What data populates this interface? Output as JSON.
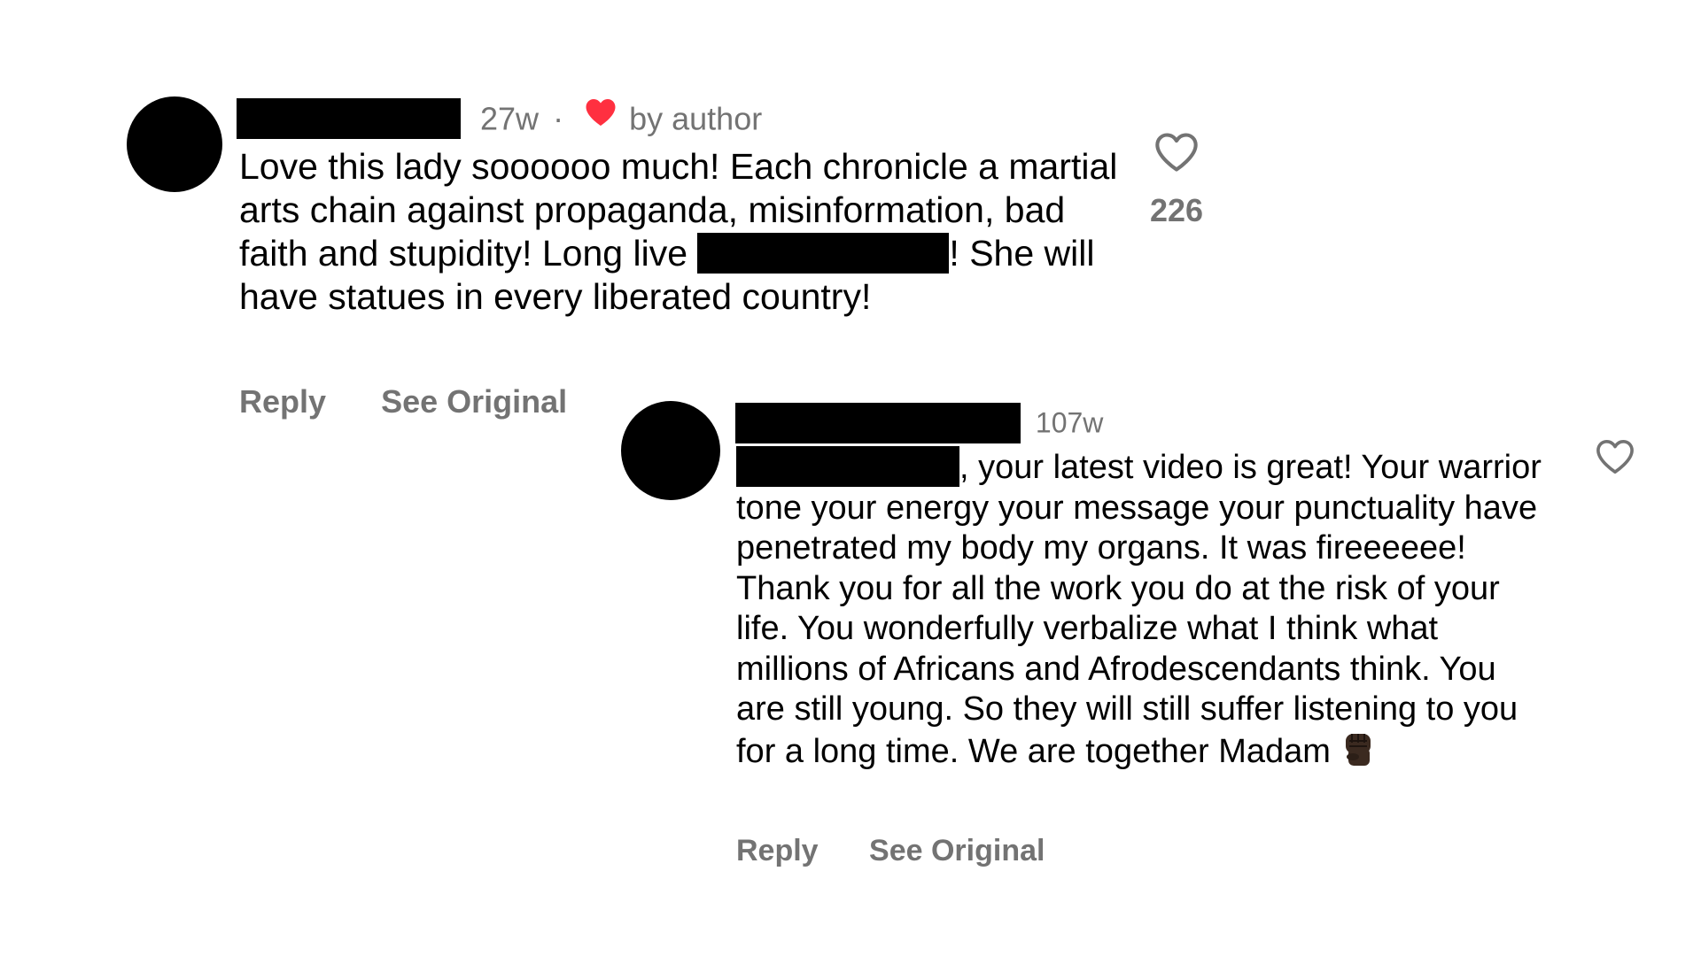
{
  "comments": [
    {
      "time": "27w",
      "separator": "·",
      "liked_by_author": "by author",
      "text_before_mention": "Love this lady soooooo much! Each chronicle a martial arts chain against propaganda, misinformation, bad faith and stupidity! Long live",
      "text_after_mention": "! She will have statues in every liberated country!",
      "like_count": "226",
      "actions": {
        "reply": "Reply",
        "see_original": "See Original"
      }
    },
    {
      "time": "107w",
      "text_after_mention": ", your latest video is great! Your warrior tone your energy your message your punctuality have penetrated my body my organs. It was fireeeeee! Thank you for all the work you do at the risk of your life. You wonderfully verbalize what I think what millions of Africans and Afrodescendants think. You are still young. So they will still suffer listening to you for a long time. We are together Madam",
      "emoji": "raised-fist-dark-skin",
      "actions": {
        "reply": "Reply",
        "see_original": "See Original"
      }
    }
  ],
  "colors": {
    "text": "#000000",
    "muted": "#737373",
    "heart": "#ff3040",
    "redaction": "#000000"
  },
  "icons": [
    "heart-outline-icon",
    "heart-filled-icon",
    "raised-fist-emoji"
  ]
}
